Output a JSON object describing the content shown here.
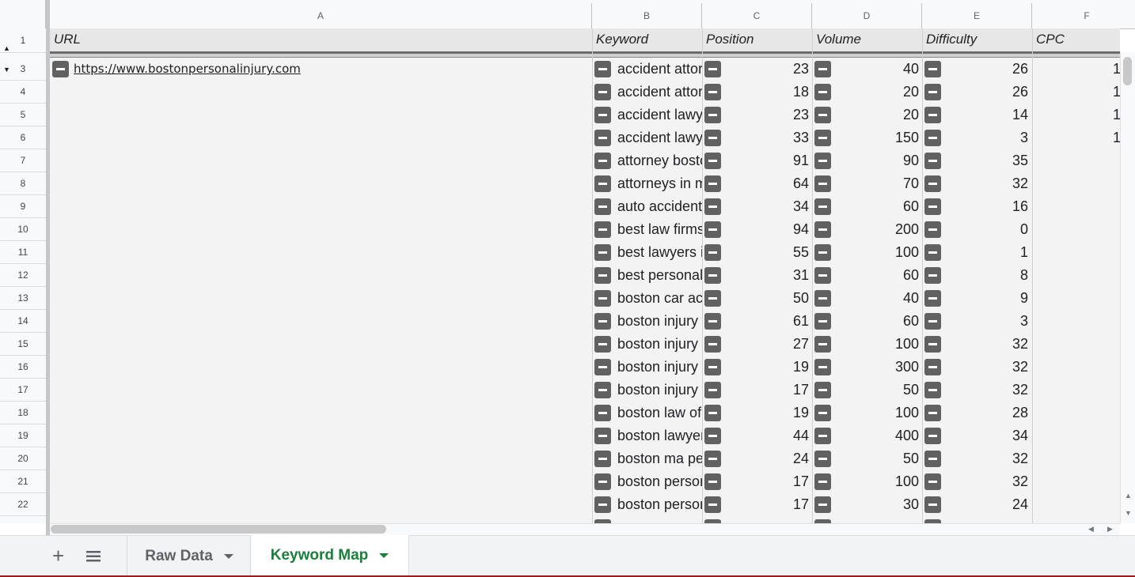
{
  "columns": [
    "A",
    "B",
    "C",
    "D",
    "E",
    "F"
  ],
  "header_row": {
    "row_num": "1",
    "url": "URL",
    "keyword": "Keyword",
    "position": "Position",
    "volume": "Volume",
    "difficulty": "Difficulty",
    "cpc": "CPC"
  },
  "url_value": "https://www.bostonpersonalinjury.com",
  "rows": [
    {
      "n": "3",
      "kw": "accident attor",
      "pos": "23",
      "vol": "40",
      "diff": "26",
      "cpc": "1"
    },
    {
      "n": "4",
      "kw": "accident attor",
      "pos": "18",
      "vol": "20",
      "diff": "26",
      "cpc": "1"
    },
    {
      "n": "5",
      "kw": "accident lawy",
      "pos": "23",
      "vol": "20",
      "diff": "14",
      "cpc": "1"
    },
    {
      "n": "6",
      "kw": "accident lawy",
      "pos": "33",
      "vol": "150",
      "diff": "3",
      "cpc": "1"
    },
    {
      "n": "7",
      "kw": "attorney bosto",
      "pos": "91",
      "vol": "90",
      "diff": "35",
      "cpc": ""
    },
    {
      "n": "8",
      "kw": "attorneys in m",
      "pos": "64",
      "vol": "70",
      "diff": "32",
      "cpc": ""
    },
    {
      "n": "9",
      "kw": "auto accident",
      "pos": "34",
      "vol": "60",
      "diff": "16",
      "cpc": ""
    },
    {
      "n": "10",
      "kw": "best law firms",
      "pos": "94",
      "vol": "200",
      "diff": "0",
      "cpc": ""
    },
    {
      "n": "11",
      "kw": "best lawyers i",
      "pos": "55",
      "vol": "100",
      "diff": "1",
      "cpc": ""
    },
    {
      "n": "12",
      "kw": "best personal",
      "pos": "31",
      "vol": "60",
      "diff": "8",
      "cpc": ""
    },
    {
      "n": "13",
      "kw": "boston car ac",
      "pos": "50",
      "vol": "40",
      "diff": "9",
      "cpc": ""
    },
    {
      "n": "14",
      "kw": "boston injury",
      "pos": "61",
      "vol": "60",
      "diff": "3",
      "cpc": ""
    },
    {
      "n": "15",
      "kw": "boston injury",
      "pos": "27",
      "vol": "100",
      "diff": "32",
      "cpc": ""
    },
    {
      "n": "16",
      "kw": "boston injury",
      "pos": "19",
      "vol": "300",
      "diff": "32",
      "cpc": ""
    },
    {
      "n": "17",
      "kw": "boston injury",
      "pos": "17",
      "vol": "50",
      "diff": "32",
      "cpc": ""
    },
    {
      "n": "18",
      "kw": "boston law of",
      "pos": "19",
      "vol": "100",
      "diff": "28",
      "cpc": ""
    },
    {
      "n": "19",
      "kw": "boston lawyer",
      "pos": "44",
      "vol": "400",
      "diff": "34",
      "cpc": ""
    },
    {
      "n": "20",
      "kw": "boston ma pe",
      "pos": "24",
      "vol": "50",
      "diff": "32",
      "cpc": ""
    },
    {
      "n": "21",
      "kw": "boston persor",
      "pos": "17",
      "vol": "100",
      "diff": "32",
      "cpc": ""
    },
    {
      "n": "22",
      "kw": "boston persor",
      "pos": "17",
      "vol": "30",
      "diff": "24",
      "cpc": ""
    }
  ],
  "sheet_tabs": [
    {
      "label": "Raw Data",
      "active": false
    },
    {
      "label": "Keyword Map",
      "active": true
    }
  ],
  "icons": {
    "add_sheet": "plus-icon",
    "all_sheets": "menu-icon",
    "group_collapse": "minus-icon"
  },
  "colors": {
    "active_tab": "#188038",
    "group_toggle": "#616161"
  }
}
